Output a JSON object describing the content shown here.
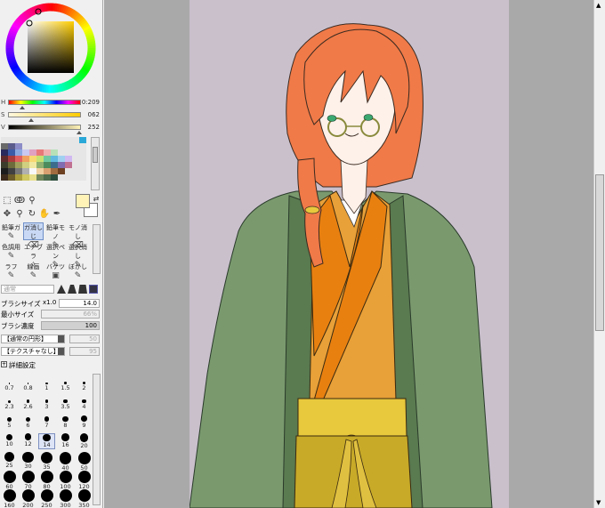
{
  "color": {
    "h_label": "H",
    "h_value": "0:209",
    "s_label": "S",
    "s_value": "062",
    "v_label": "V",
    "v_value": "252",
    "h_frac": 0.2,
    "s_frac": 0.32,
    "v_frac": 0.98
  },
  "swatches": [
    "#e6e6e6",
    "#e6e6e6",
    "#e6e6e6",
    "#e6e6e6",
    "#e6e6e6",
    "#e6e6e6",
    "#e6e6e6",
    "#e6e6e6",
    "#e6e6e6",
    "#e6e6e6",
    "#e6e6e6",
    "#2aa8d8",
    "#6a6a6a",
    "#5c5c8c",
    "#8c8cc8",
    "#e6e6e6",
    "#e6e6e6",
    "#e6e6e6",
    "#e6e6e6",
    "#e6e6e6",
    "#e6e6e6",
    "#e6e6e6",
    "#e6e6e6",
    "#e6e6e6",
    "#2a2a5c",
    "#3c5ca8",
    "#8aa8e0",
    "#c8c8f0",
    "#e0a0c0",
    "#e87878",
    "#f0b0b0",
    "#b8e0b8",
    "#e6e6e6",
    "#e6e6e6",
    "#e6e6e6",
    "#e6e6e6",
    "#5c2a2a",
    "#a83c3c",
    "#e06060",
    "#f0a060",
    "#f8d870",
    "#c8e070",
    "#70c8a0",
    "#60b8e0",
    "#a0d0f0",
    "#d0b8f0",
    "#e6e6e6",
    "#e6e6e6",
    "#3c3c2a",
    "#6c6c3c",
    "#a0a05c",
    "#d0d080",
    "#f0e8a0",
    "#90b070",
    "#4c8c5c",
    "#3c6c8c",
    "#806cb0",
    "#c07090",
    "#e6e6e6",
    "#e6e6e6",
    "#1c1c1c",
    "#404040",
    "#787878",
    "#b0b0b0",
    "#f8f8f8",
    "#f0d0a0",
    "#d8a070",
    "#a06c40",
    "#6c4020",
    "#e6e6e6",
    "#e6e6e6",
    "#e6e6e6",
    "#3c2a1c",
    "#6c5c2a",
    "#a89c3c",
    "#d0c860",
    "#e8e08c",
    "#70885c",
    "#4c6c4c",
    "#2c4c3c",
    "#e6e6e6",
    "#e6e6e6",
    "#e6e6e6",
    "#e6e6e6"
  ],
  "tools": [
    {
      "label": "鉛筆ガ",
      "icon": "✎"
    },
    {
      "label": "ガ消しじ",
      "icon": "⌫"
    },
    {
      "label": "鉛筆モノ",
      "icon": "✎"
    },
    {
      "label": "モノ消し",
      "icon": "⌫"
    },
    {
      "label": "色調用",
      "icon": "✎"
    },
    {
      "label": "エアブラ",
      "icon": "✧"
    },
    {
      "label": "選択ペン",
      "icon": "✎"
    },
    {
      "label": "選択消し",
      "icon": "✎"
    },
    {
      "label": "ラフ",
      "icon": "✎"
    },
    {
      "label": "線画",
      "icon": "✎"
    },
    {
      "label": "バケツ",
      "icon": "▣"
    },
    {
      "label": "ぼかし",
      "icon": "✎"
    }
  ],
  "settings": {
    "mode": "通常",
    "brush_size_label": "ブラシサイズ",
    "brush_size_mult": "x1.0",
    "brush_size_value": "14.0",
    "min_size_label": "最小サイズ",
    "min_size_value": "66%",
    "density_label": "ブラシ濃度",
    "density_value": "100",
    "density_frac": 1.0,
    "shape_select": "【通常の円形】",
    "shape_value": "50",
    "texture_select": "【テクスチャなし】",
    "texture_value": "95",
    "detail_label": "詳細設定"
  },
  "brush_sizes": [
    [
      "0.7",
      "0.8",
      "1",
      "1.5",
      "2"
    ],
    [
      "2.3",
      "2.6",
      "3",
      "3.5",
      "4"
    ],
    [
      "5",
      "6",
      "7",
      "8",
      "9"
    ],
    [
      "10",
      "12",
      "14",
      "16",
      "20"
    ],
    [
      "25",
      "30",
      "35",
      "40",
      "50"
    ],
    [
      "60",
      "70",
      "80",
      "100",
      "120"
    ],
    [
      "160",
      "200",
      "250",
      "300",
      "350"
    ]
  ],
  "selected_size": "14",
  "colors": {
    "canvas_bg": "#c9c0cc",
    "hair": "#f07a48",
    "haori": "#7a9a6e",
    "kimono": "#e8a038",
    "obi": "#e8c83c",
    "hakama": "#c8aa28"
  }
}
